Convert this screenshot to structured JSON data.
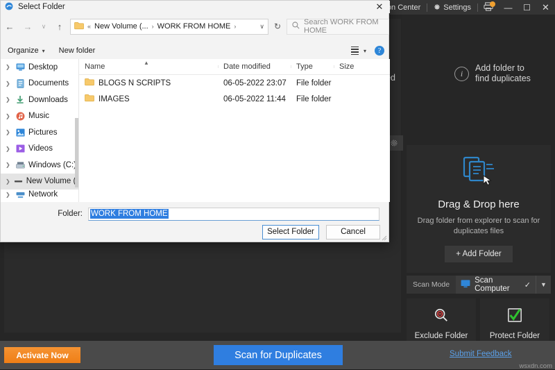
{
  "app": {
    "titlebar": {
      "action_center": "Action Center",
      "settings": "Settings",
      "minimize": "—",
      "maximize": "☐",
      "close": "✕"
    },
    "left_hint": "be saved",
    "header_addfolder_line1": "Add folder to",
    "header_addfolder_line2": "find duplicates",
    "drop_panel": {
      "title": "Drag & Drop here",
      "subtitle": "Drag folder from explorer to scan for duplicates files",
      "add_folder_button": "+  Add Folder"
    },
    "scan_mode": {
      "label": "Scan Mode",
      "value": "Scan Computer",
      "check": "✓",
      "caret": "▼"
    },
    "exclude_folder": "Exclude Folder",
    "protect_folder": "Protect Folder",
    "bottom": {
      "activate": "Activate Now",
      "scan": "Scan for Duplicates",
      "feedback": "Submit Feedback",
      "watermark": "wsxdn.com"
    },
    "colors": {
      "accent_blue": "#2f7ee0",
      "activate_orange": "#ef7e16",
      "link_blue": "#5ba0e8"
    }
  },
  "dialog": {
    "title": "Select Folder",
    "close": "✕",
    "nav": {
      "back": "←",
      "forward": "→",
      "recent": "∨",
      "up": "↑",
      "refresh": "↻",
      "address_caret": "∨"
    },
    "breadcrumb": {
      "overflow": "«",
      "items": [
        "New Volume (...",
        "WORK FROM HOME"
      ],
      "sep": "›"
    },
    "search_placeholder": "Search WORK FROM HOME",
    "commandbar": {
      "organize": "Organize",
      "organize_caret": "▾",
      "new_folder": "New folder",
      "view_caret": "▾",
      "help": "?"
    },
    "tree": [
      {
        "label": "Desktop",
        "icon": "desktop-icon",
        "selected": false
      },
      {
        "label": "Documents",
        "icon": "documents-icon",
        "selected": false
      },
      {
        "label": "Downloads",
        "icon": "downloads-icon",
        "selected": false
      },
      {
        "label": "Music",
        "icon": "music-icon",
        "selected": false
      },
      {
        "label": "Pictures",
        "icon": "pictures-icon",
        "selected": false
      },
      {
        "label": "Videos",
        "icon": "videos-icon",
        "selected": false
      },
      {
        "label": "Windows (C:)",
        "icon": "drive-icon",
        "selected": false
      },
      {
        "label": "New Volume (D",
        "icon": "drive-icon",
        "selected": true
      },
      {
        "label": "Network",
        "icon": "network-icon",
        "selected": false
      }
    ],
    "columns": [
      "Name",
      "Date modified",
      "Type",
      "Size"
    ],
    "files": [
      {
        "name": "BLOGS N SCRIPTS",
        "date": "06-05-2022 23:07",
        "type": "File folder",
        "size": ""
      },
      {
        "name": "IMAGES",
        "date": "06-05-2022 11:44",
        "type": "File folder",
        "size": ""
      }
    ],
    "folder_field": {
      "label": "Folder:",
      "value": "WORK FROM HOME"
    },
    "buttons": {
      "select": "Select Folder",
      "cancel": "Cancel"
    }
  }
}
